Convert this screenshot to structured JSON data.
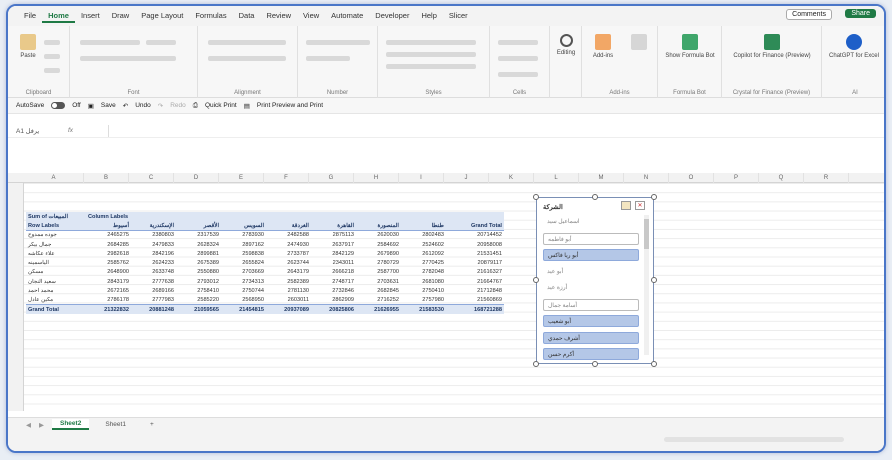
{
  "menu": [
    "File",
    "Home",
    "Insert",
    "Draw",
    "Page Layout",
    "Formulas",
    "Data",
    "Review",
    "View",
    "Automate",
    "Developer",
    "Help",
    "Slicer"
  ],
  "menu_active": "Home",
  "top_right": {
    "comments": "Comments",
    "share": "Share"
  },
  "ribbon": {
    "groups": [
      "Clipboard",
      "Font",
      "Alignment",
      "Number",
      "Styles",
      "Cells",
      "Add-ins",
      "Formula Bot",
      "Crystal for Finance (Preview)",
      "AI"
    ],
    "buttons": {
      "paste": "Paste",
      "editing": "Editing",
      "addins": "Add-ins",
      "show_formula_bot": "Show Formula Bot",
      "copilot": "Copilot for Finance (Preview)",
      "chatgpt": "ChatGPT for Excel"
    }
  },
  "qat": {
    "autosave": "AutoSave",
    "toggle": "Off",
    "save": "Save",
    "undo": "Undo",
    "redo": "Redo",
    "quick_print": "Quick Print",
    "print_preview": "Print Preview and Print"
  },
  "name_box": "A1 يرفل",
  "fx": "fx",
  "columns": [
    "A",
    "B",
    "C",
    "D",
    "E",
    "F",
    "G",
    "H",
    "I",
    "J",
    "K",
    "L",
    "M",
    "N",
    "O",
    "P",
    "Q",
    "R"
  ],
  "pivot": {
    "corner": "Sum of المبيعات",
    "column_labels": "Column Labels",
    "row_labels": "Row Labels",
    "headers": [
      "أسيوط",
      "الإسكندرية",
      "الأقصر",
      "السويس",
      "الغردقة",
      "القاهرة",
      "المنصورة",
      "طنطا",
      "Grand Total"
    ],
    "rows": [
      {
        "label": "جوده ممدوح",
        "values": [
          "2465275",
          "2380803",
          "2317539",
          "2783930",
          "2482588",
          "2875113",
          "2620030",
          "2802483",
          "20714452"
        ]
      },
      {
        "label": "جمال بيكر",
        "values": [
          "2684285",
          "2479833",
          "2628324",
          "2897162",
          "2474930",
          "2637917",
          "2584692",
          "2524602",
          "20958008"
        ]
      },
      {
        "label": "علاء عكاشه",
        "values": [
          "2982618",
          "2842196",
          "2899881",
          "2598838",
          "2733787",
          "2842129",
          "2679890",
          "2612092",
          "21531451"
        ]
      },
      {
        "label": "الياسمينه",
        "values": [
          "2585762",
          "2624233",
          "2675389",
          "2655824",
          "2623744",
          "2343011",
          "2780729",
          "2770425",
          "20879117"
        ]
      },
      {
        "label": "مسكن",
        "values": [
          "2648900",
          "2633748",
          "2550880",
          "2703669",
          "2643179",
          "2666218",
          "2587700",
          "2782048",
          "21616327"
        ]
      },
      {
        "label": "سعيد النجان",
        "values": [
          "2843179",
          "2777638",
          "2793012",
          "2734313",
          "2582389",
          "2748717",
          "2703631",
          "2681080",
          "21664767"
        ]
      },
      {
        "label": "محمد احمد",
        "values": [
          "2672165",
          "2689166",
          "2758410",
          "2750744",
          "2781130",
          "2732846",
          "2682845",
          "2750410",
          "21712848"
        ]
      },
      {
        "label": "مكين عادل",
        "values": [
          "2786178",
          "2777983",
          "2585220",
          "2568950",
          "2603011",
          "2862909",
          "2716252",
          "2757980",
          "21560869"
        ]
      }
    ],
    "grand_total": {
      "label": "Grand Total",
      "values": [
        "21322832",
        "20881248",
        "21059565",
        "21454815",
        "20937089",
        "20825806",
        "21626955",
        "21583530",
        "168721288"
      ]
    }
  },
  "slicer": {
    "title": "الشركة",
    "items": [
      {
        "label": "اسماعيل سيد",
        "state": "unsel"
      },
      {
        "label": "أبو فاطمه",
        "state": "boxed"
      },
      {
        "label": "أبو ريا فاكس",
        "state": "sel"
      },
      {
        "label": "أبو عيد",
        "state": "unsel"
      },
      {
        "label": "أرزة عيد",
        "state": "unsel"
      },
      {
        "label": "أسامة جمال",
        "state": "boxed"
      },
      {
        "label": "أبو شعيب",
        "state": "sel"
      },
      {
        "label": "أشرف حمدي",
        "state": "sel"
      },
      {
        "label": "أكرم حسن",
        "state": "sel"
      }
    ]
  },
  "sheets": {
    "active": "Sheet2",
    "other": "Sheet1",
    "add": "+"
  }
}
